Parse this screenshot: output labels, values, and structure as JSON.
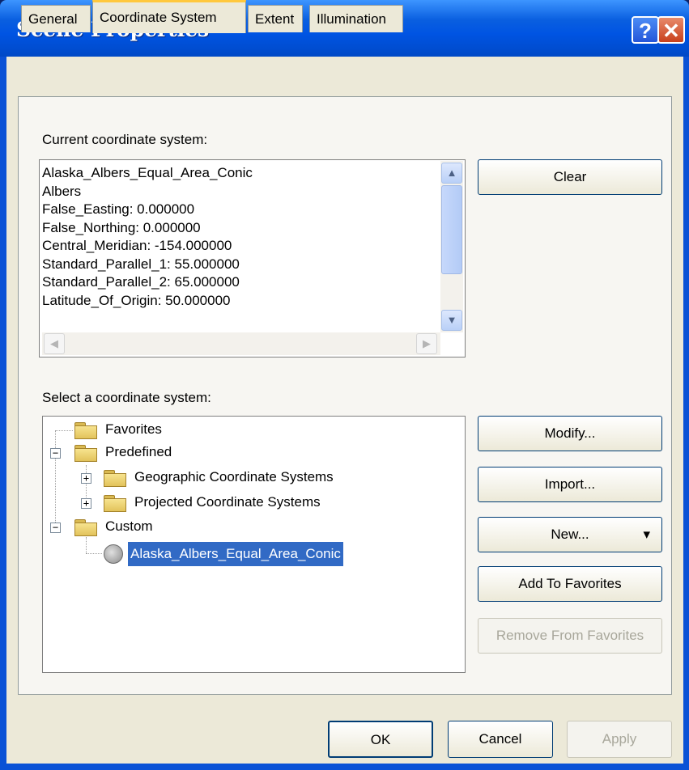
{
  "window": {
    "title": "Scene Properties",
    "help_glyph": "?",
    "close_glyph": "✕"
  },
  "tabs": [
    {
      "label": "General"
    },
    {
      "label": "Coordinate System"
    },
    {
      "label": "Extent"
    },
    {
      "label": "Illumination"
    }
  ],
  "current_cs": {
    "label": "Current coordinate system:",
    "lines": [
      "Alaska_Albers_Equal_Area_Conic",
      "Albers",
      "False_Easting: 0.000000",
      "False_Northing: 0.000000",
      "Central_Meridian: -154.000000",
      "Standard_Parallel_1: 55.000000",
      "Standard_Parallel_2: 65.000000",
      "Latitude_Of_Origin: 50.000000"
    ]
  },
  "select_cs": {
    "label": "Select a coordinate system:",
    "tree": {
      "favorites": "Favorites",
      "predefined": "Predefined",
      "geographic": "Geographic Coordinate Systems",
      "projected": "Projected Coordinate Systems",
      "custom": "Custom",
      "custom_item": "Alaska_Albers_Equal_Area_Conic"
    }
  },
  "buttons": {
    "clear": "Clear",
    "modify": "Modify...",
    "import": "Import...",
    "new": "New...",
    "new_arrow": "▾",
    "add_favorites": "Add To Favorites",
    "remove_favorites": "Remove From Favorites",
    "ok": "OK",
    "cancel": "Cancel",
    "apply": "Apply"
  },
  "colors": {
    "selection": "#316ac5",
    "titlebar": "#0054e3",
    "tab_highlight": "#ffc83c"
  }
}
